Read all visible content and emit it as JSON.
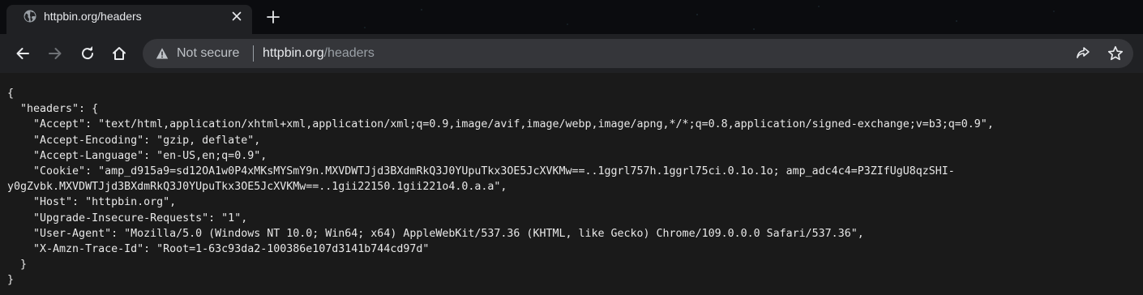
{
  "tab": {
    "title": "httpbin.org/headers",
    "favicon": "globe-icon"
  },
  "toolbar": {
    "security_label": "Not secure",
    "url_host": "httpbin.org",
    "url_path": "/headers"
  },
  "content": {
    "json_lines": [
      "{",
      "  \"headers\": {",
      "    \"Accept\": \"text/html,application/xhtml+xml,application/xml;q=0.9,image/avif,image/webp,image/apng,*/*;q=0.8,application/signed-exchange;v=b3;q=0.9\",",
      "    \"Accept-Encoding\": \"gzip, deflate\",",
      "    \"Accept-Language\": \"en-US,en;q=0.9\",",
      "    \"Cookie\": \"amp_d915a9=sd12OA1w0P4xMKsMYSmY9n.MXVDWTJjd3BXdmRkQ3J0YUpuTkx3OE5JcXVKMw==..1ggrl757h.1ggrl75ci.0.1o.1o; amp_adc4c4=P3ZIfUgU8qzSHI-",
      "y0gZvbk.MXVDWTJjd3BXdmRkQ3J0YUpuTkx3OE5JcXVKMw==..1gii22150.1gii221o4.0.a.a\",",
      "    \"Host\": \"httpbin.org\",",
      "    \"Upgrade-Insecure-Requests\": \"1\",",
      "    \"User-Agent\": \"Mozilla/5.0 (Windows NT 10.0; Win64; x64) AppleWebKit/537.36 (KHTML, like Gecko) Chrome/109.0.0.0 Safari/537.36\",",
      "    \"X-Amzn-Trace-Id\": \"Root=1-63c93da2-100386e107d3141b744cd97d\"",
      "  }",
      "}"
    ]
  },
  "colors": {
    "tabstrip_bg": "#0b0c0f",
    "toolbar_bg": "#202124",
    "omnibox_bg": "#35363a",
    "page_bg": "#1a1a1a"
  }
}
